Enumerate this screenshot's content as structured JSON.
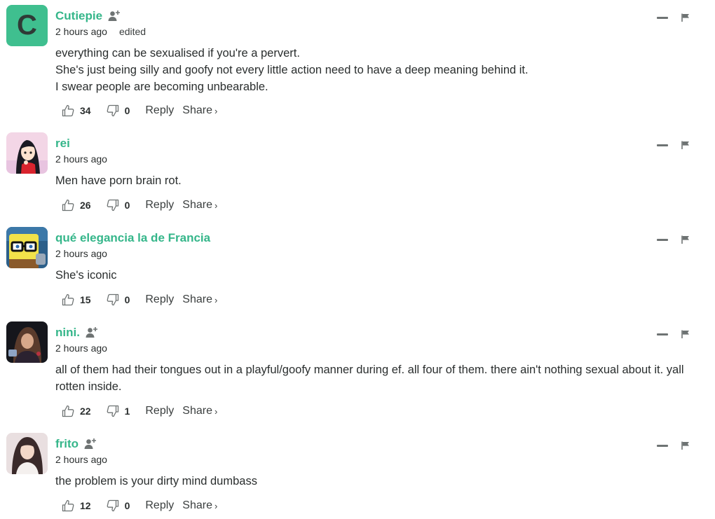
{
  "comments": [
    {
      "username": "Cutiepie",
      "avatar_letter": "C",
      "time": "2 hours ago",
      "edited": "edited",
      "lines": [
        "everything can be sexualised if you're a pervert.",
        "She's just being silly and goofy not every little action need to have a deep meaning behind it.",
        "I swear people are becoming unbearable."
      ],
      "likes": "34",
      "dislikes": "0",
      "reply_label": "Reply",
      "share_label": "Share"
    },
    {
      "username": "rei",
      "time": "2 hours ago",
      "lines": [
        "Men have porn brain rot."
      ],
      "likes": "26",
      "dislikes": "0",
      "reply_label": "Reply",
      "share_label": "Share"
    },
    {
      "username": "qué elegancia la de Francia",
      "time": "2 hours ago",
      "lines": [
        "She's iconic"
      ],
      "likes": "15",
      "dislikes": "0",
      "reply_label": "Reply",
      "share_label": "Share"
    },
    {
      "username": "nini.",
      "time": "2 hours ago",
      "lines": [
        "all of them had their tongues out in a playful/goofy manner during ef. all four of them. there ain't nothing sexual about it. yall",
        "rotten inside."
      ],
      "likes": "22",
      "dislikes": "1",
      "reply_label": "Reply",
      "share_label": "Share"
    },
    {
      "username": "frito",
      "time": "2 hours ago",
      "lines": [
        "the problem is your dirty mind dumbass"
      ],
      "likes": "12",
      "dislikes": "0",
      "reply_label": "Reply",
      "share_label": "Share"
    }
  ],
  "colors": {
    "username": "#35b68a",
    "avatar_bg": "#3fbf8f",
    "icon": "#6e7373"
  }
}
